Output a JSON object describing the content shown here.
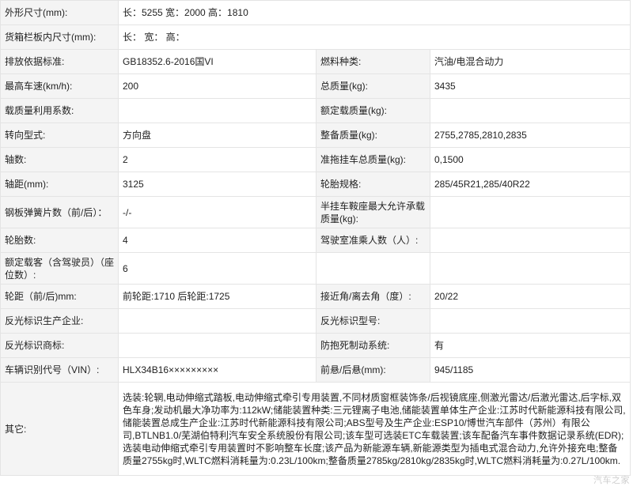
{
  "rows": [
    {
      "l1": "外形尺寸(mm):",
      "v1": "长：5255 宽：2000 高：1810"
    },
    {
      "l1": "货箱栏板内尺寸(mm):",
      "v1": "长：  宽：  高："
    },
    {
      "l1": "排放依据标准:",
      "v1": "GB18352.6-2016国VI",
      "l2": "燃料种类:",
      "v2": "汽油/电混合动力"
    },
    {
      "l1": "最高车速(km/h):",
      "v1": "200",
      "l2": "总质量(kg):",
      "v2": "3435"
    },
    {
      "l1": "载质量利用系数:",
      "v1": "",
      "l2": "额定载质量(kg):",
      "v2": ""
    },
    {
      "l1": "转向型式:",
      "v1": "方向盘",
      "l2": "整备质量(kg):",
      "v2": "2755,2785,2810,2835"
    },
    {
      "l1": "轴数:",
      "v1": "2",
      "l2": "准拖挂车总质量(kg):",
      "v2": "0,1500"
    },
    {
      "l1": "轴距(mm):",
      "v1": "3125",
      "l2": "轮胎规格:",
      "v2": "285/45R21,285/40R22"
    },
    {
      "l1": "钢板弹簧片数（前/后）：",
      "v1": "-/-",
      "l2": "半挂车鞍座最大允许承载质量(kg):",
      "v2": ""
    },
    {
      "l1": "轮胎数:",
      "v1": "4",
      "l2": "驾驶室准乘人数（人）:",
      "v2": ""
    },
    {
      "l1": "额定载客（含驾驶员）（座位数）:",
      "v1": "6",
      "l2": "",
      "v2": ""
    },
    {
      "l1": "轮距（前/后)mm:",
      "v1": "前轮距:1710 后轮距:1725",
      "l2": "接近角/离去角（度）:",
      "v2": "20/22"
    },
    {
      "l1": "反光标识生产企业:",
      "v1": "",
      "l2": "反光标识型号:",
      "v2": ""
    },
    {
      "l1": "反光标识商标:",
      "v1": "",
      "l2": "防抱死制动系统:",
      "v2": "有"
    },
    {
      "l1": "车辆识别代号（VIN）:",
      "v1": "HLX34B16×××××××××",
      "l2": "前悬/后悬(mm):",
      "v2": "945/1185"
    }
  ],
  "other": {
    "label": "其它:",
    "text": "选装:轮辋,电动伸缩式踏板,电动伸缩式牵引专用装置,不同材质窗框装饰条/后视镜底座,侧激光雷达/后激光雷达,后字标,双色车身;发动机最大净功率为:112kW;储能装置种类:三元锂离子电池,储能装置单体生产企业:江苏时代新能源科技有限公司,储能装置总成生产企业:江苏时代新能源科技有限公司;ABS型号及生产企业:ESP10/博世汽车部件（苏州）有限公司,BTLNB1.0/芜湖伯特利汽车安全系统股份有限公司;该车型可选装ETC车载装置;该车配备汽车事件数据记录系统(EDR);选装电动伸缩式牵引专用装置时不影响整车长度;该产品为新能源车辆,新能源类型为插电式混合动力,允许外接充电;整备质量2755kg时,WLTC燃料消耗量为:0.23L/100km;整备质量2785kg/2810kg/2835kg时,WLTC燃料消耗量为:0.27L/100km."
  },
  "watermark": "汽车之家"
}
